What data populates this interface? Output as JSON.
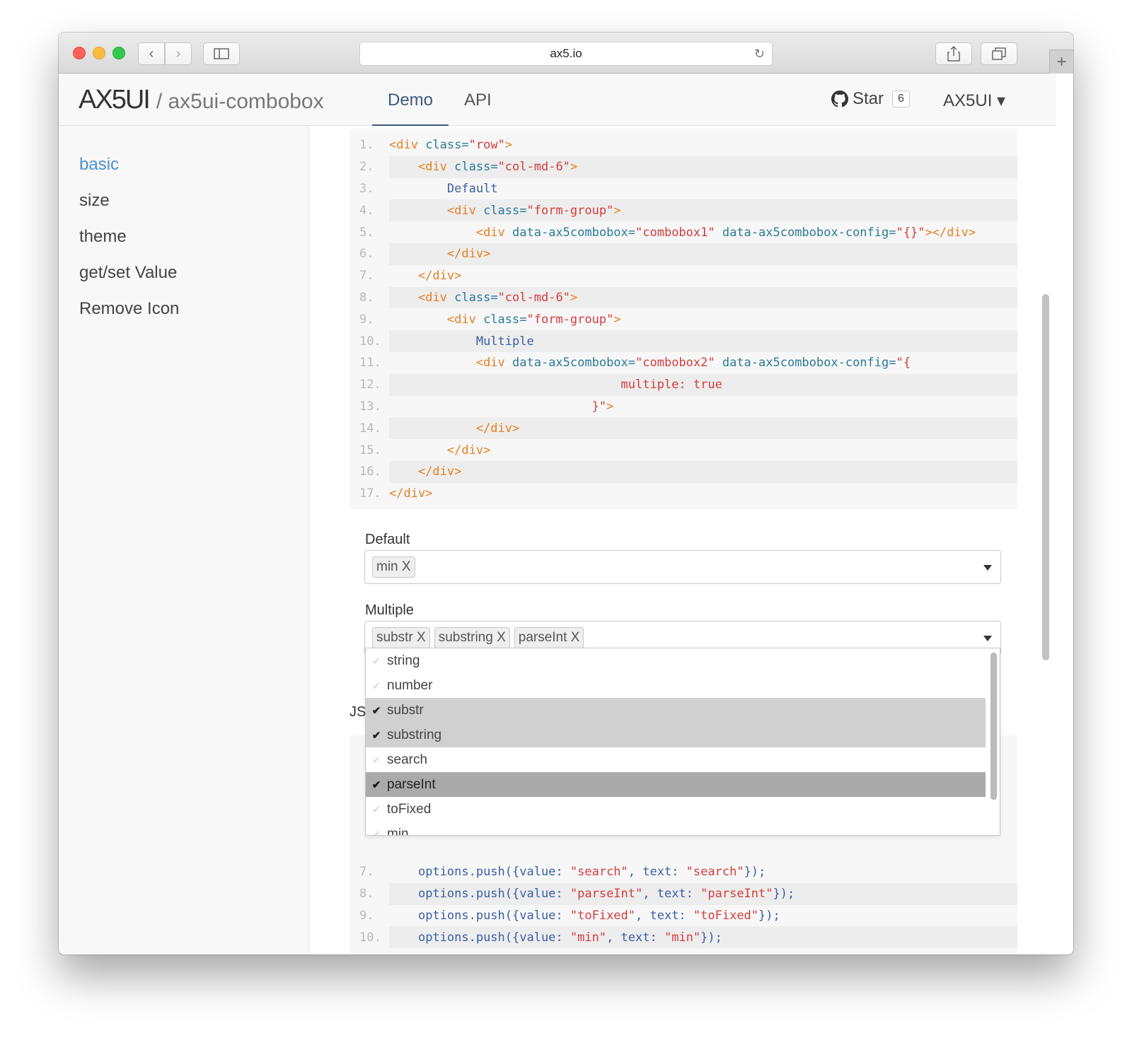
{
  "browser": {
    "url": "ax5.io",
    "newtab_label": "+"
  },
  "site": {
    "logo_mark": "AX5UI",
    "logo_sub": "/ ax5ui-combobox",
    "nav": [
      {
        "label": "Demo",
        "active": true
      },
      {
        "label": "API",
        "active": false
      }
    ],
    "star_label": "Star",
    "star_count": "6",
    "menu_label": "AX5UI ▾"
  },
  "sidebar": {
    "items": [
      {
        "label": "basic",
        "active": true
      },
      {
        "label": "size",
        "active": false
      },
      {
        "label": "theme",
        "active": false
      },
      {
        "label": "get/set Value",
        "active": false
      },
      {
        "label": "Remove Icon",
        "active": false
      }
    ]
  },
  "html_code": {
    "lines": [
      {
        "n": "1.",
        "parts": [
          [
            "t-tag",
            "<div "
          ],
          [
            "t-attr",
            "class="
          ],
          [
            "t-str",
            "\"row\""
          ],
          [
            "t-tag",
            ">"
          ]
        ]
      },
      {
        "n": "2.",
        "parts": [
          [
            "",
            "    "
          ],
          [
            "t-tag",
            "<div "
          ],
          [
            "t-attr",
            "class="
          ],
          [
            "t-str",
            "\"col-md-6\""
          ],
          [
            "t-tag",
            ">"
          ]
        ]
      },
      {
        "n": "3.",
        "parts": [
          [
            "",
            "        "
          ],
          [
            "t-kw",
            "Default"
          ]
        ]
      },
      {
        "n": "4.",
        "parts": [
          [
            "",
            "        "
          ],
          [
            "t-tag",
            "<div "
          ],
          [
            "t-attr",
            "class="
          ],
          [
            "t-str",
            "\"form-group\""
          ],
          [
            "t-tag",
            ">"
          ]
        ]
      },
      {
        "n": "5.",
        "parts": [
          [
            "",
            "            "
          ],
          [
            "t-tag",
            "<div "
          ],
          [
            "t-attr",
            "data-ax5combobox="
          ],
          [
            "t-str",
            "\"combobox1\""
          ],
          [
            "t-attr",
            " data-ax5combobox-config="
          ],
          [
            "t-str",
            "\"{}\""
          ],
          [
            "t-tag",
            "></div>"
          ]
        ]
      },
      {
        "n": "6.",
        "parts": [
          [
            "",
            "        "
          ],
          [
            "t-tag",
            "</div>"
          ]
        ]
      },
      {
        "n": "7.",
        "parts": [
          [
            "",
            "    "
          ],
          [
            "t-tag",
            "</div>"
          ]
        ]
      },
      {
        "n": "8.",
        "parts": [
          [
            "",
            "    "
          ],
          [
            "t-tag",
            "<div "
          ],
          [
            "t-attr",
            "class="
          ],
          [
            "t-str",
            "\"col-md-6\""
          ],
          [
            "t-tag",
            ">"
          ]
        ]
      },
      {
        "n": "9.",
        "parts": [
          [
            "",
            "        "
          ],
          [
            "t-tag",
            "<div "
          ],
          [
            "t-attr",
            "class="
          ],
          [
            "t-str",
            "\"form-group\""
          ],
          [
            "t-tag",
            ">"
          ]
        ]
      },
      {
        "n": "10.",
        "parts": [
          [
            "",
            "            "
          ],
          [
            "t-kw",
            "Multiple"
          ]
        ]
      },
      {
        "n": "11.",
        "parts": [
          [
            "",
            "            "
          ],
          [
            "t-tag",
            "<div "
          ],
          [
            "t-attr",
            "data-ax5combobox="
          ],
          [
            "t-str",
            "\"combobox2\""
          ],
          [
            "t-attr",
            " data-ax5combobox-config="
          ],
          [
            "t-str",
            "\"{"
          ]
        ]
      },
      {
        "n": "12.",
        "parts": [
          [
            "",
            "                                "
          ],
          [
            "t-str",
            "multiple: true"
          ]
        ]
      },
      {
        "n": "13.",
        "parts": [
          [
            "",
            "                            "
          ],
          [
            "t-str",
            "}\""
          ],
          [
            "t-tag",
            ">"
          ]
        ]
      },
      {
        "n": "14.",
        "parts": [
          [
            "",
            "            "
          ],
          [
            "t-tag",
            "</div>"
          ]
        ]
      },
      {
        "n": "15.",
        "parts": [
          [
            "",
            "        "
          ],
          [
            "t-tag",
            "</div>"
          ]
        ]
      },
      {
        "n": "16.",
        "parts": [
          [
            "",
            "    "
          ],
          [
            "t-tag",
            "</div>"
          ]
        ]
      },
      {
        "n": "17.",
        "parts": [
          [
            "t-tag",
            "</div>"
          ]
        ]
      }
    ]
  },
  "form": {
    "default_label": "Default",
    "default_chips": [
      "min X"
    ],
    "multiple_label": "Multiple",
    "multiple_chips": [
      "substr X",
      "substring X",
      "parseInt X"
    ]
  },
  "dropdown": {
    "options": [
      {
        "label": "string",
        "state": "none"
      },
      {
        "label": "number",
        "state": "none"
      },
      {
        "label": "substr",
        "state": "selected"
      },
      {
        "label": "substring",
        "state": "selected"
      },
      {
        "label": "search",
        "state": "none"
      },
      {
        "label": "parseInt",
        "state": "focus"
      },
      {
        "label": "toFixed",
        "state": "none"
      },
      {
        "label": "min",
        "state": "none"
      }
    ]
  },
  "js_label": "JS",
  "js_code": {
    "lines": [
      {
        "n": "7.",
        "parts": [
          [
            "",
            "    "
          ],
          [
            "t-kw",
            "options.push({value: "
          ],
          [
            "t-str",
            "\"search\""
          ],
          [
            "t-kw",
            ", text: "
          ],
          [
            "t-str",
            "\"search\""
          ],
          [
            "t-kw",
            "});"
          ]
        ]
      },
      {
        "n": "8.",
        "parts": [
          [
            "",
            "    "
          ],
          [
            "t-kw",
            "options.push({value: "
          ],
          [
            "t-str",
            "\"parseInt\""
          ],
          [
            "t-kw",
            ", text: "
          ],
          [
            "t-str",
            "\"parseInt\""
          ],
          [
            "t-kw",
            "});"
          ]
        ]
      },
      {
        "n": "9.",
        "parts": [
          [
            "",
            "    "
          ],
          [
            "t-kw",
            "options.push({value: "
          ],
          [
            "t-str",
            "\"toFixed\""
          ],
          [
            "t-kw",
            ", text: "
          ],
          [
            "t-str",
            "\"toFixed\""
          ],
          [
            "t-kw",
            "});"
          ]
        ]
      },
      {
        "n": "10.",
        "parts": [
          [
            "",
            "    "
          ],
          [
            "t-kw",
            "options.push({value: "
          ],
          [
            "t-str",
            "\"min\""
          ],
          [
            "t-kw",
            ", text: "
          ],
          [
            "t-str",
            "\"min\""
          ],
          [
            "t-kw",
            "});"
          ]
        ]
      }
    ]
  }
}
